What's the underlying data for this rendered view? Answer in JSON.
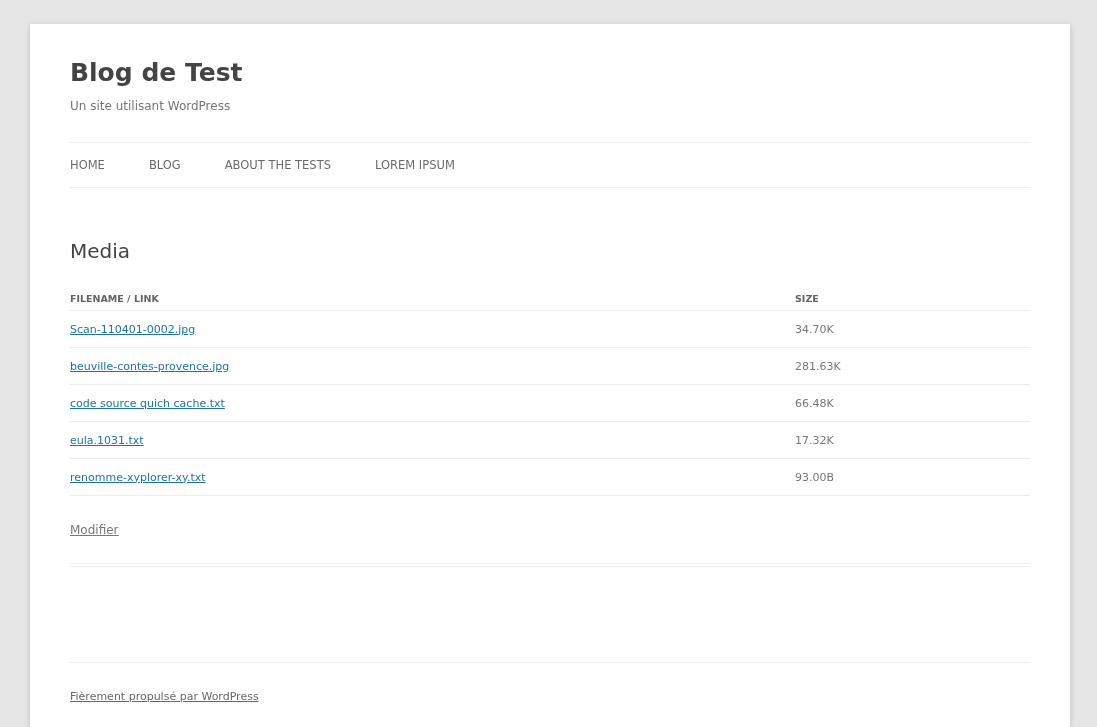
{
  "site": {
    "title": "Blog de Test",
    "tagline": "Un site utilisant WordPress"
  },
  "nav": [
    "HOME",
    "BLOG",
    "ABOUT THE TESTS",
    "LOREM IPSUM"
  ],
  "page": {
    "title": "Media"
  },
  "table": {
    "columns": [
      "FILENAME / LINK",
      "SIZE"
    ],
    "rows": [
      {
        "filename": "Scan-110401-0002.jpg",
        "size": "34.70K"
      },
      {
        "filename": "beuville-contes-provence.jpg",
        "size": "281.63K"
      },
      {
        "filename": "code source quich cache.txt",
        "size": "66.48K"
      },
      {
        "filename": "eula.1031.txt",
        "size": "17.32K"
      },
      {
        "filename": "renomme-xyplorer-xy.txt",
        "size": "93.00B"
      }
    ]
  },
  "edit_link": "Modifier",
  "footer": "Fièrement propulsé par WordPress"
}
